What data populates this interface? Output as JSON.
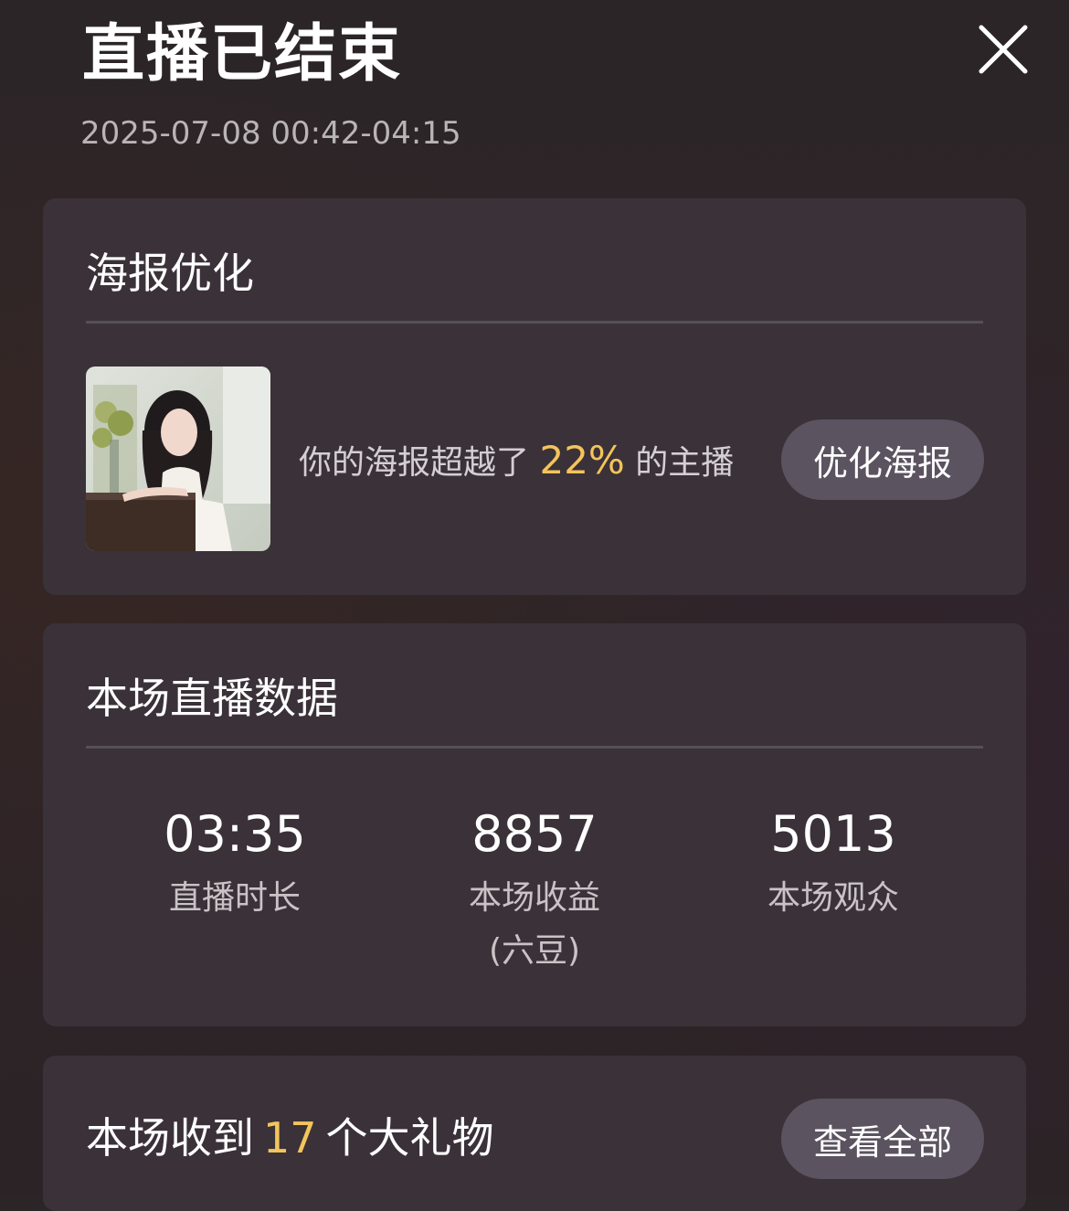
{
  "header": {
    "title": "直播已结束",
    "time_range": "2025-07-08 00:42-04:15",
    "close_icon": "close-icon"
  },
  "poster_card": {
    "title": "海报优化",
    "text_prefix": "你的海报超越了",
    "percent": "22%",
    "text_suffix": "的主播",
    "button_label": "优化海报"
  },
  "stats_card": {
    "title": "本场直播数据",
    "stats": [
      {
        "value": "03:35",
        "label": "直播时长",
        "sublabel": ""
      },
      {
        "value": "8857",
        "label": "本场收益",
        "sublabel": "(六豆)"
      },
      {
        "value": "5013",
        "label": "本场观众",
        "sublabel": ""
      }
    ]
  },
  "gifts_card": {
    "title_prefix": "本场收到",
    "count": "17",
    "title_suffix": "个大礼物",
    "button_label": "查看全部"
  },
  "colors": {
    "accent": "#f4c45c",
    "card_bg": "#3a3238",
    "button_bg": "#5b5360"
  }
}
